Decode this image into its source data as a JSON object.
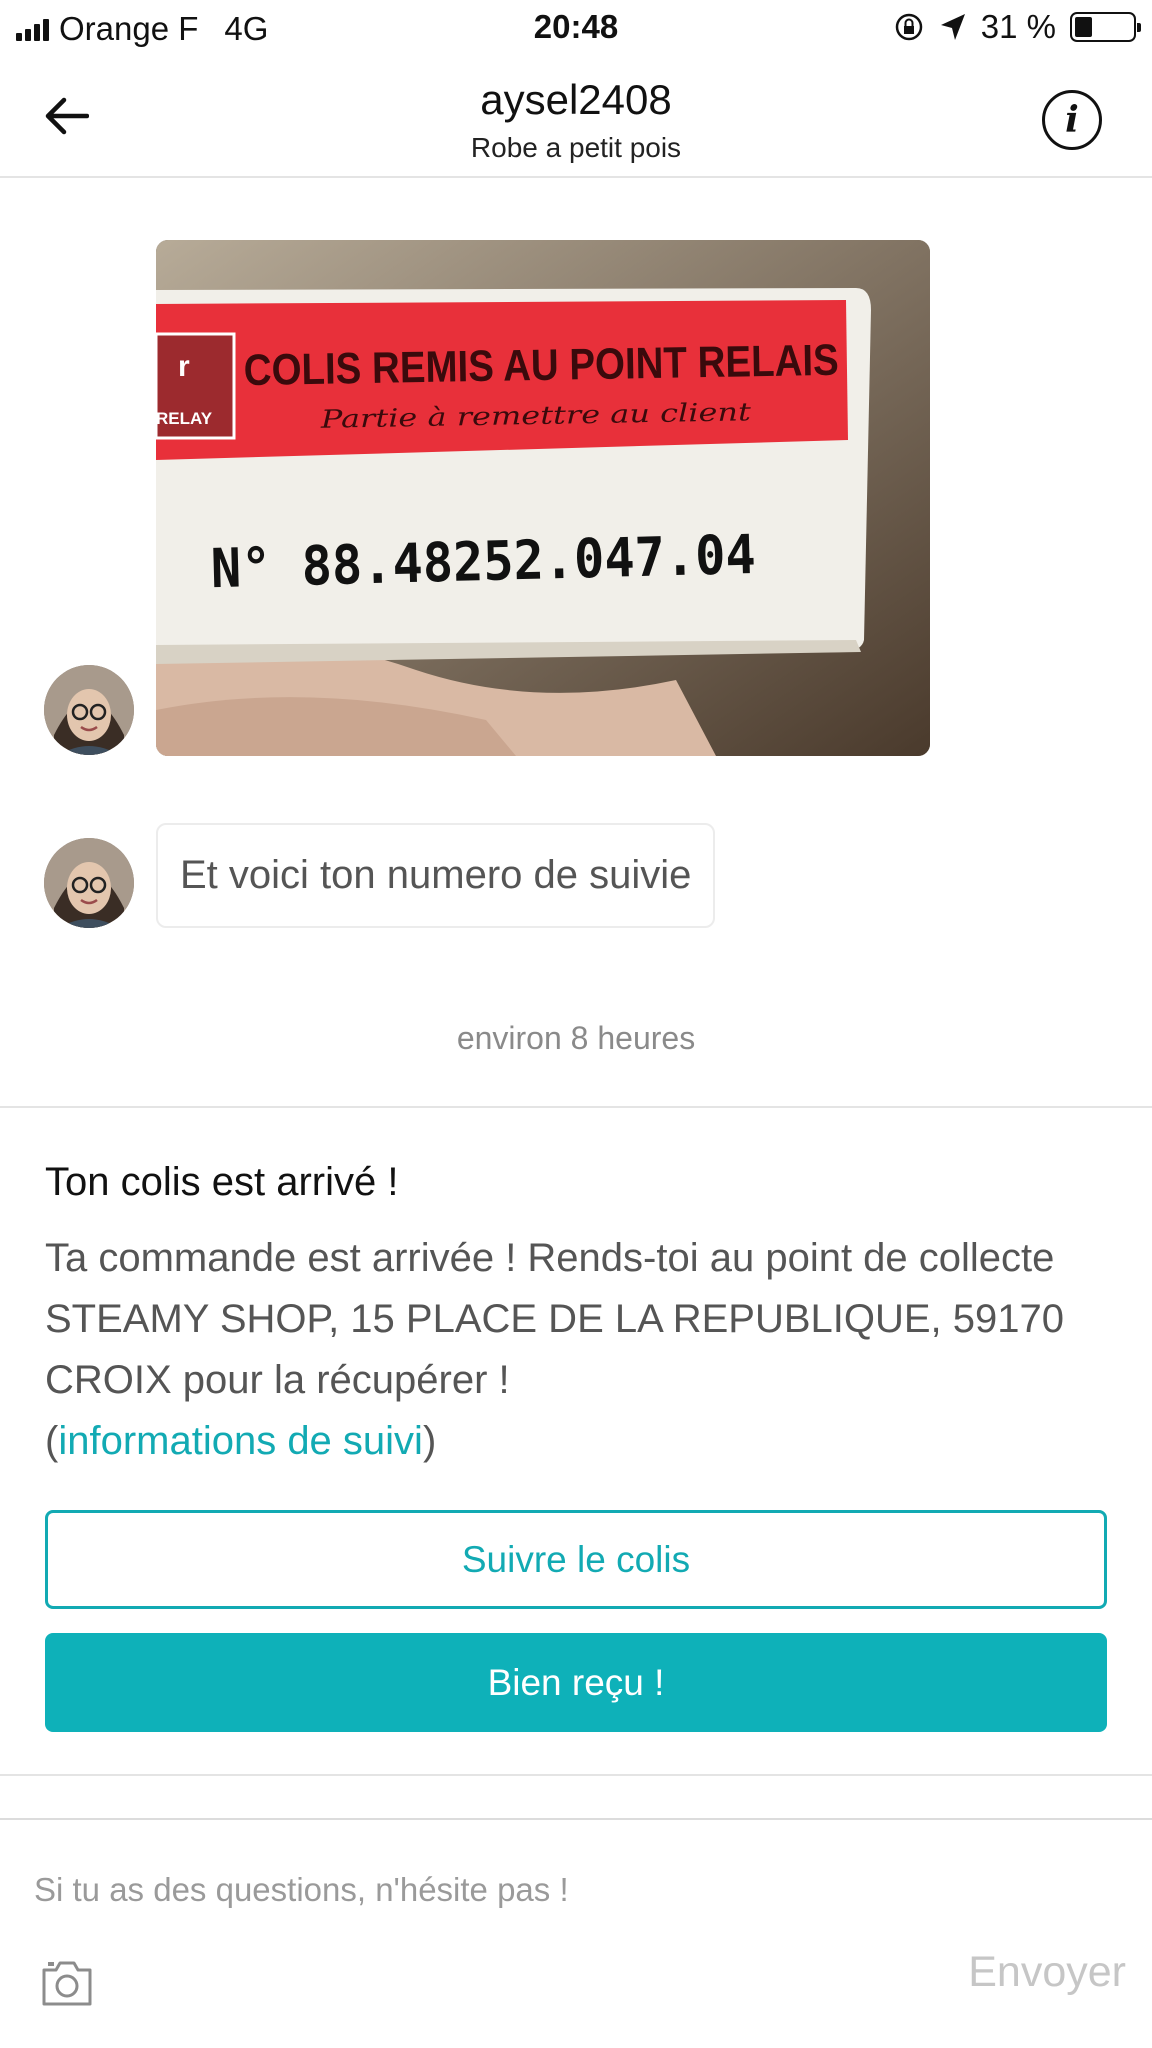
{
  "status_bar": {
    "carrier": "Orange F",
    "network": "4G",
    "time": "20:48",
    "battery": "31 %",
    "battery_level": 0.31
  },
  "header": {
    "title": "aysel2408",
    "subtitle": "Robe  a petit pois",
    "back_icon": "arrow-left-icon",
    "info_icon": "info-icon"
  },
  "messages": {
    "photo": {
      "banner_title": "COLIS REMIS AU POINT RELAIS",
      "banner_subtitle": "Partie à remettre au client",
      "logo_text": "RELAY",
      "tracking_number": "N° 88.48252.047.04"
    },
    "text": "Et voici ton numero de suivie",
    "timestamp": "environ 8 heures"
  },
  "notification": {
    "title": "Ton colis est arrivé !",
    "body": "Ta commande est arrivée ! Rends-toi au point de collecte STEAMY SHOP, 15 PLACE DE LA REPUBLIQUE, 59170 CROIX pour la récupérer ! ",
    "link_open": "(",
    "link_text": "informations de suivi",
    "link_close": ")",
    "track_button": "Suivre le colis",
    "received_button": "Bien reçu !"
  },
  "composer": {
    "placeholder": "Si tu as des questions, n'hésite pas !",
    "send_label": "Envoyer",
    "camera_icon": "camera-icon"
  },
  "colors": {
    "accent": "#0eb1b9",
    "link": "#12aab3",
    "banner_red": "#e8303a"
  }
}
